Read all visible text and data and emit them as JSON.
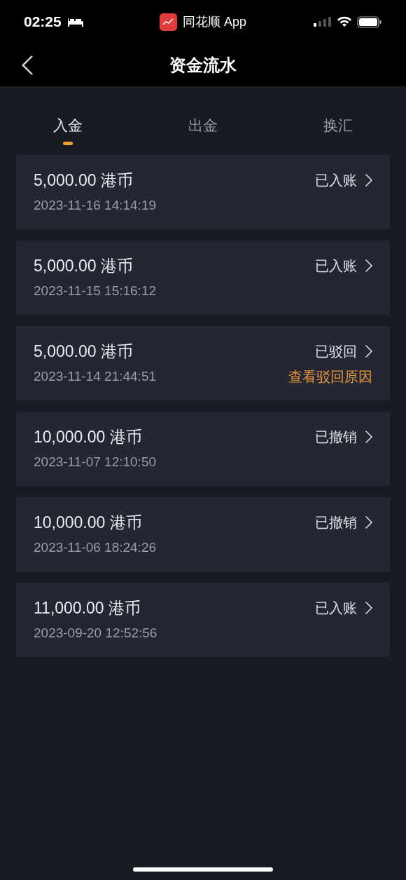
{
  "status_bar": {
    "time": "02:25",
    "app": "同花顺 App"
  },
  "nav": {
    "title": "资金流水"
  },
  "tabs": [
    {
      "label": "入金",
      "selected": true
    },
    {
      "label": "出金",
      "selected": false
    },
    {
      "label": "换汇",
      "selected": false
    }
  ],
  "records": [
    {
      "amount": "5,000.00 港币",
      "time": "2023-11-16 14:14:19",
      "status": "已入账"
    },
    {
      "amount": "5,000.00 港币",
      "time": "2023-11-15 15:16:12",
      "status": "已入账"
    },
    {
      "amount": "5,000.00 港币",
      "time": "2023-11-14 21:44:51",
      "status": "已驳回",
      "reason_link": "查看驳回原因"
    },
    {
      "amount": "10,000.00 港币",
      "time": "2023-11-07 12:10:50",
      "status": "已撤销"
    },
    {
      "amount": "10,000.00 港币",
      "time": "2023-11-06 18:24:26",
      "status": "已撤销"
    },
    {
      "amount": "11,000.00 港币",
      "time": "2023-09-20 12:52:56",
      "status": "已入账"
    }
  ]
}
